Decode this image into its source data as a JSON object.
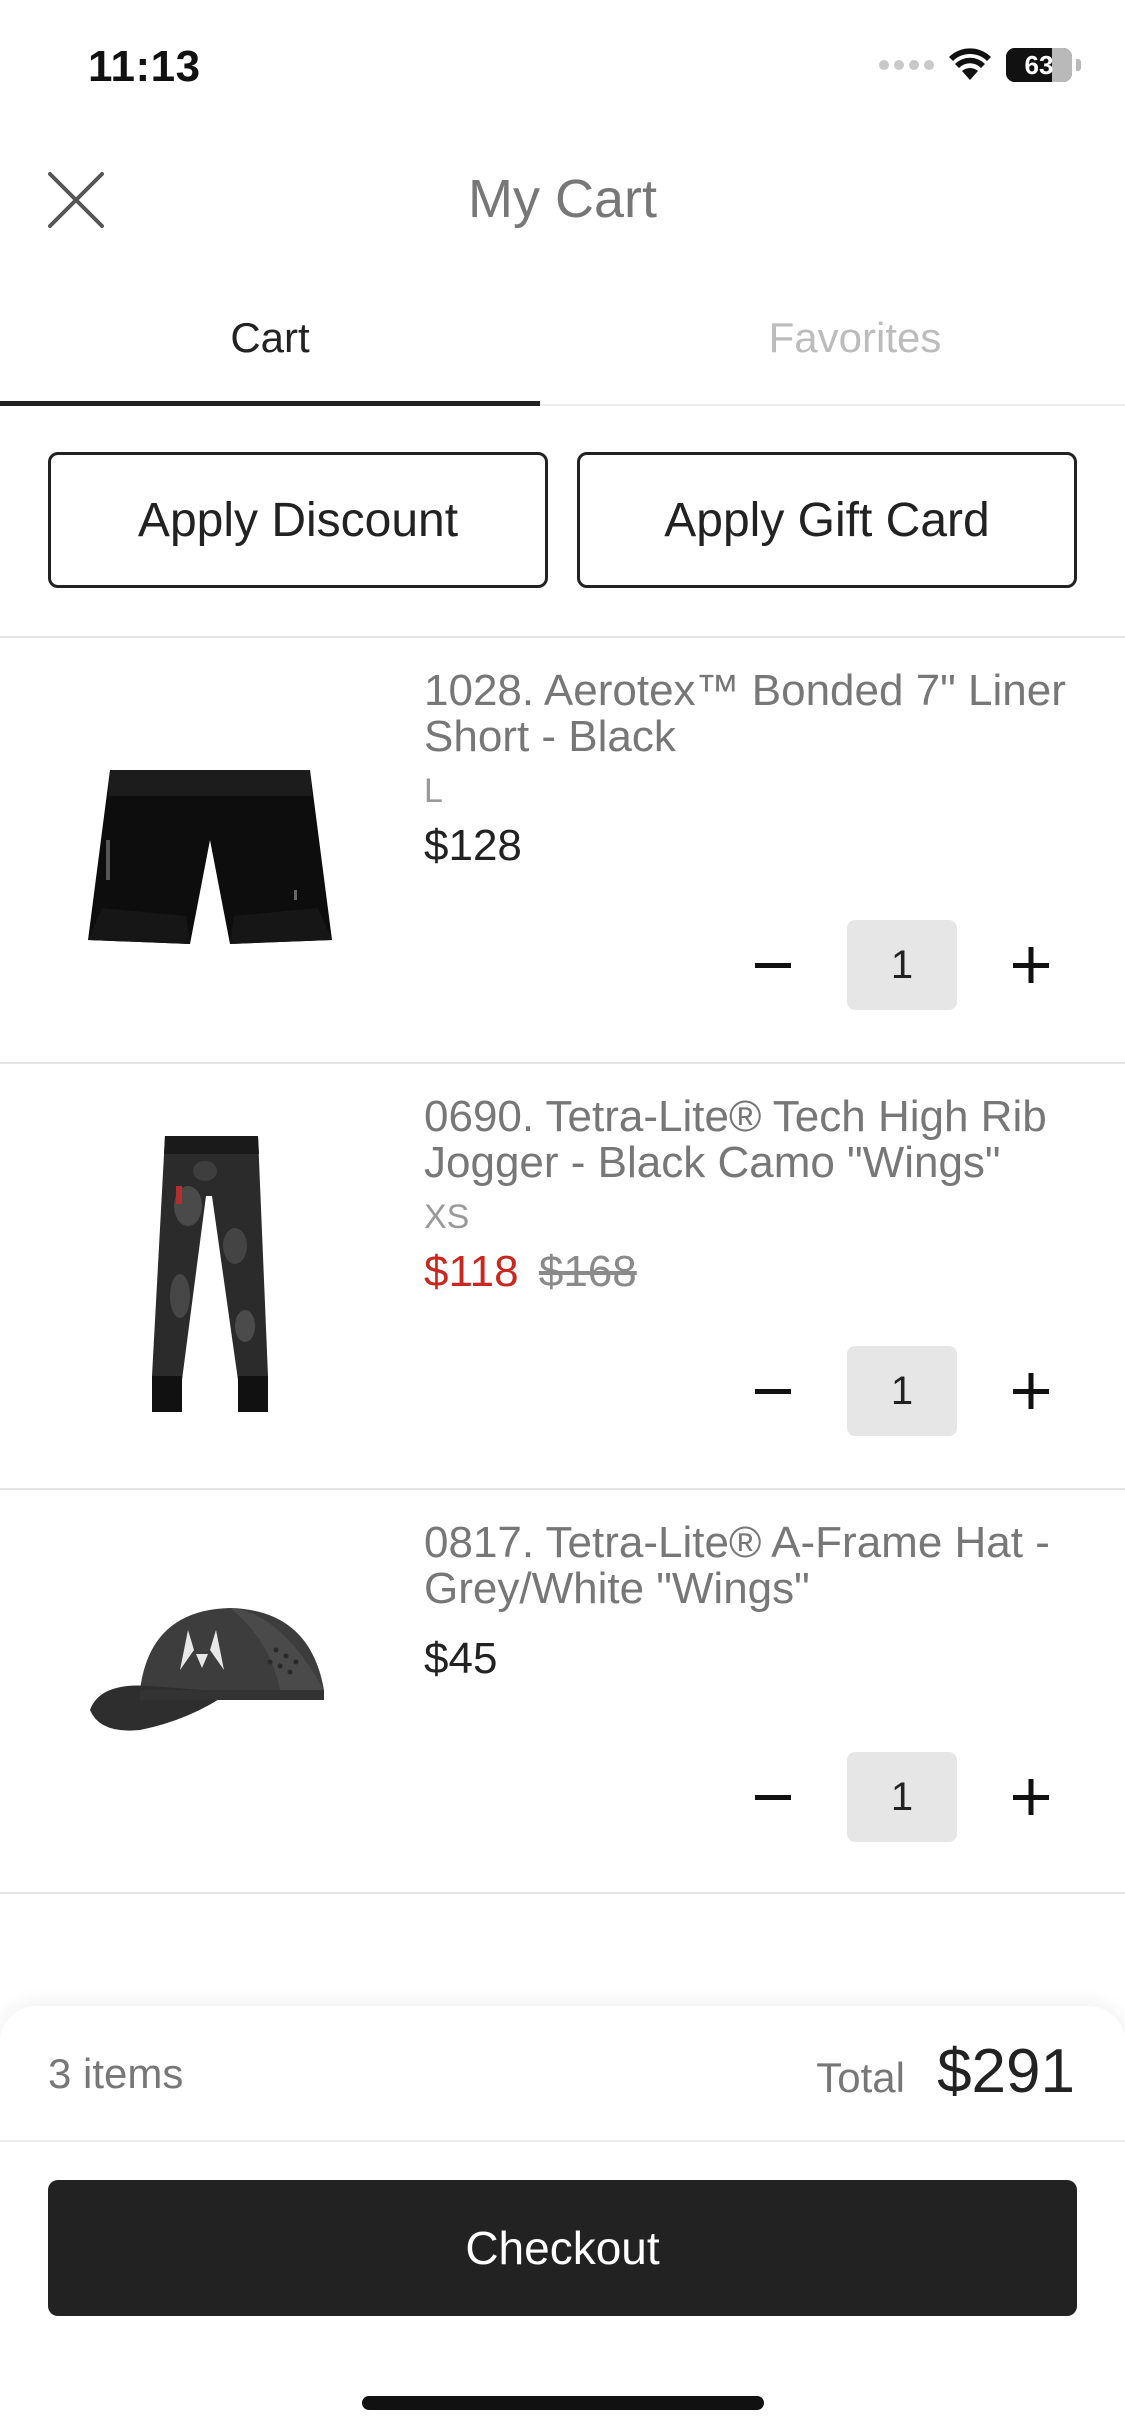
{
  "status_bar": {
    "time": "11:13",
    "battery": "63"
  },
  "header": {
    "title": "My Cart",
    "close_icon": "close-icon"
  },
  "tabs": [
    {
      "label": "Cart",
      "active": true
    },
    {
      "label": "Favorites",
      "active": false
    }
  ],
  "actions": {
    "discount_label": "Apply Discount",
    "gift_card_label": "Apply Gift Card"
  },
  "items": [
    {
      "name": "1028. Aerotex™ Bonded 7\" Liner Short - Black",
      "size": "L",
      "price": "$128",
      "quantity": "1"
    },
    {
      "name": "0690. Tetra-Lite® Tech High Rib Jogger - Black Camo \"Wings\"",
      "size": "XS",
      "price": "$118",
      "original_price": "$168",
      "quantity": "1"
    },
    {
      "name": "0817. Tetra-Lite® A-Frame Hat - Grey/White \"Wings\"",
      "price": "$45",
      "quantity": "1"
    }
  ],
  "qty_controls": {
    "minus": "−",
    "plus": "+"
  },
  "summary": {
    "items_count": "3 items",
    "total_label": "Total",
    "total_value": "$291"
  },
  "checkout": {
    "label": "Checkout"
  },
  "colors": {
    "sale_red": "#c8281f",
    "button_dark": "#222222",
    "qty_bg": "#e6e6e6"
  }
}
